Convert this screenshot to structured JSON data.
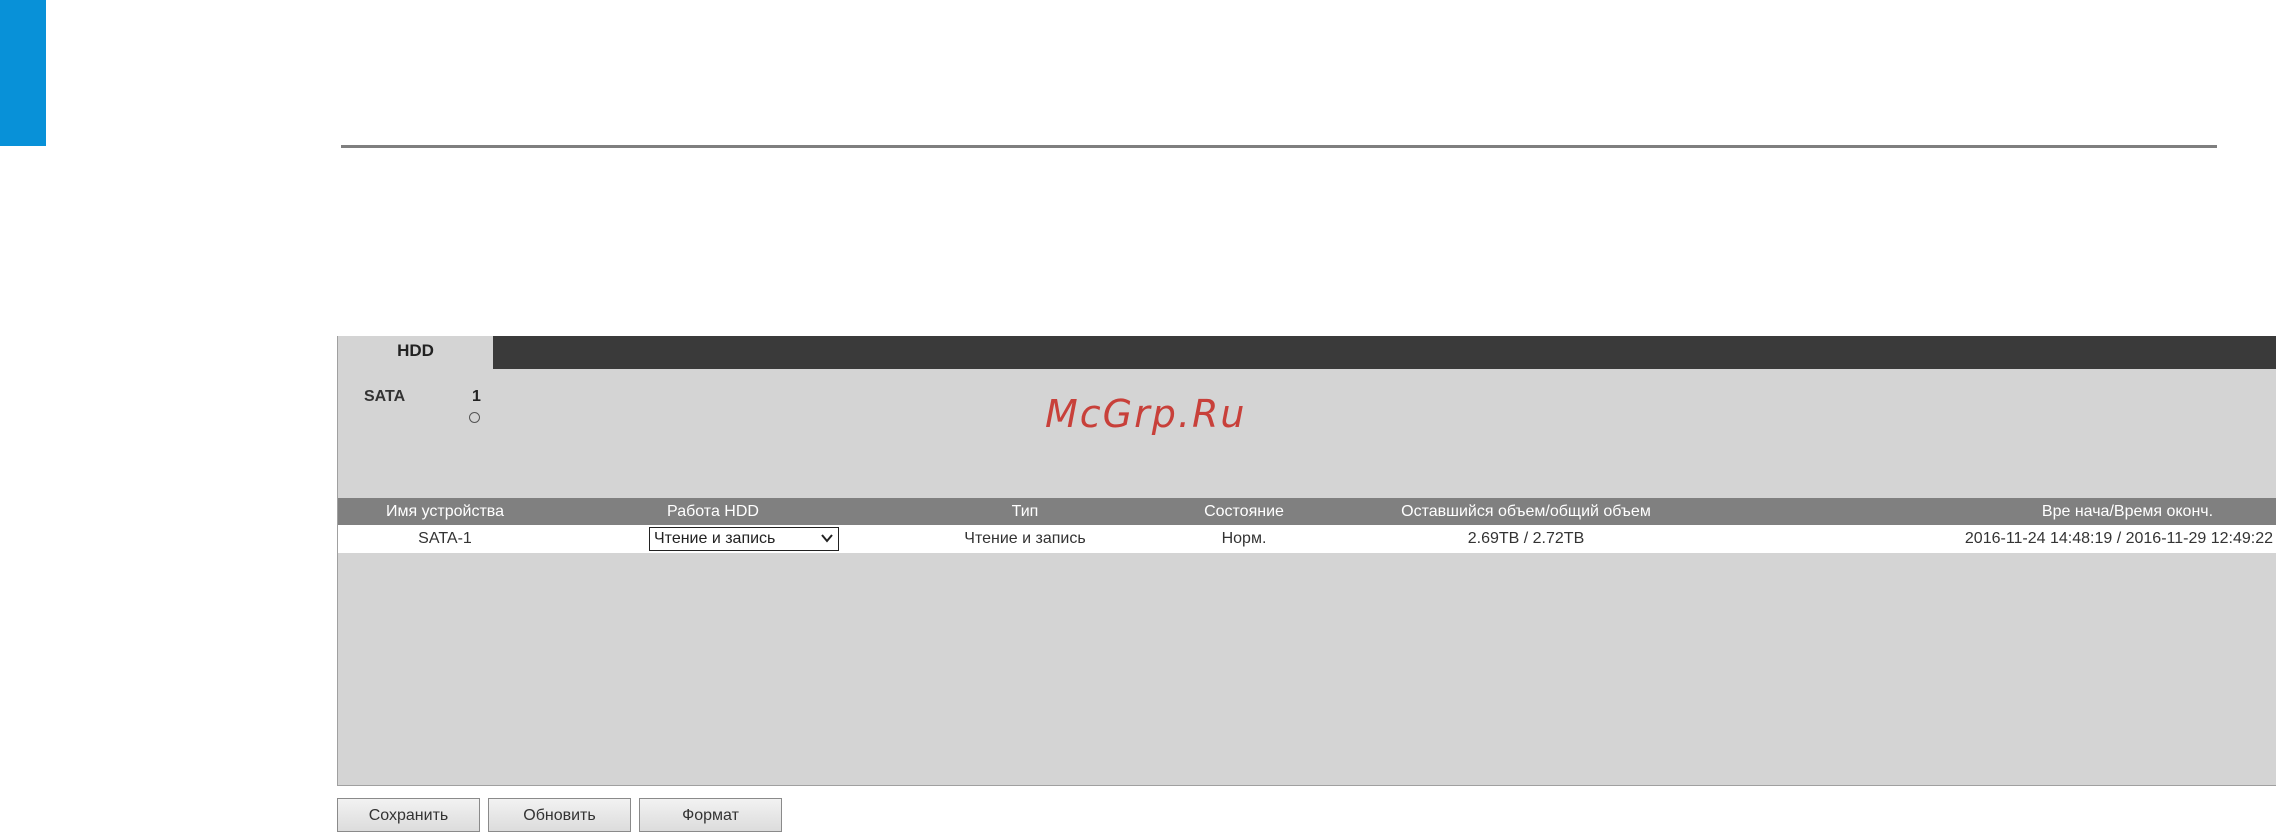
{
  "colors": {
    "accent_blue": "#0891d8",
    "panel_bg": "#d4d4d4",
    "tab_strip": "#3a3a3a",
    "table_header": "#808080",
    "watermark": "#c8403a"
  },
  "watermark": "McGrp.Ru",
  "tabs": [
    {
      "label": "HDD",
      "active": true
    }
  ],
  "sata": {
    "label": "SATA",
    "port_number": "1"
  },
  "table": {
    "headers": {
      "device_name": "Имя устройства",
      "hdd_mode": "Работа HDD",
      "type": "Тип",
      "status": "Состояние",
      "capacity": "Оставшийся объем/общий объем",
      "time_range": "Вре начa/Время оконч."
    },
    "rows": [
      {
        "device_name": "SATA-1",
        "hdd_mode_selected": "Чтение и запись",
        "type": "Чтение и запись",
        "status": "Норм.",
        "capacity": "2.69TB / 2.72TB",
        "time_range": "2016-11-24 14:48:19 / 2016-11-29 12:49:22"
      }
    ]
  },
  "buttons": {
    "save": "Сохранить",
    "refresh": "Обновить",
    "format": "Формат"
  }
}
